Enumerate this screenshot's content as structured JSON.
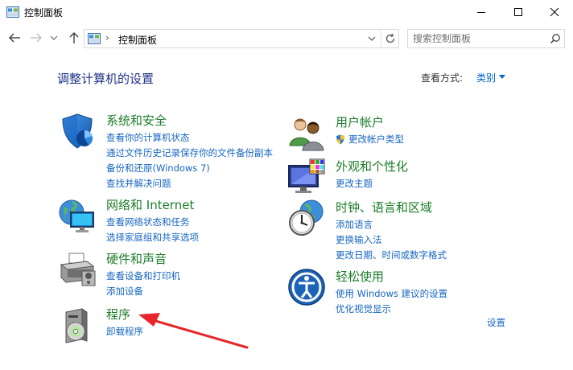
{
  "window": {
    "title": "控制面板"
  },
  "address": {
    "path": "控制面板",
    "separator": "›"
  },
  "search": {
    "placeholder": "搜索控制面板"
  },
  "main": {
    "heading": "调整计算机的设置",
    "view_by_label": "查看方式:",
    "view_by_value": "类别"
  },
  "categories": [
    {
      "title": "系统和安全",
      "icon": "shield-icon",
      "links": [
        "查看你的计算机状态",
        "通过文件历史记录保存你的文件备份副本",
        "备份和还原(Windows 7)",
        "查找并解决问题"
      ]
    },
    {
      "title": "网络和 Internet",
      "icon": "network-globe-icon",
      "links": [
        "查看网络状态和任务",
        "选择家庭组和共享选项"
      ]
    },
    {
      "title": "硬件和声音",
      "icon": "printer-icon",
      "links": [
        "查看设备和打印机",
        "添加设备"
      ]
    },
    {
      "title": "程序",
      "icon": "programs-disc-icon",
      "links": [
        "卸载程序"
      ]
    },
    {
      "title": "用户帐户",
      "icon": "users-icon",
      "links": [
        "更改帐户类型"
      ]
    },
    {
      "title": "外观和个性化",
      "icon": "appearance-monitor-icon",
      "links": [
        "更改主题"
      ]
    },
    {
      "title": "时钟、语言和区域",
      "icon": "clock-globe-icon",
      "links": [
        "添加语言",
        "更换输入法",
        "更改日期、时间或数字格式"
      ]
    },
    {
      "title": "轻松使用",
      "icon": "ease-of-access-icon",
      "links": [
        "使用 Windows 建议的设置",
        "优化视觉显示"
      ]
    }
  ],
  "partial_link": "设置",
  "colors": {
    "heading": "#1e3287",
    "category_title": "#1c7e2a",
    "link": "#1666c1",
    "annotation_arrow": "#e8262a"
  }
}
